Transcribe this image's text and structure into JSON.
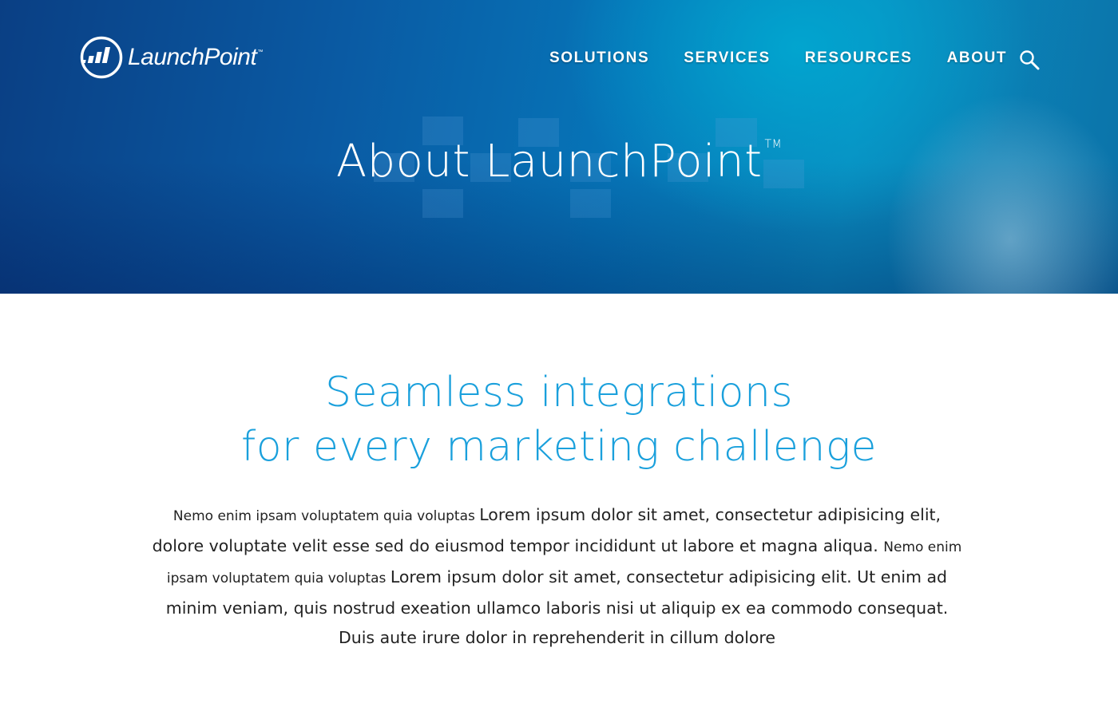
{
  "brand": {
    "name": "LaunchPoint",
    "tm": "™"
  },
  "nav": {
    "items": [
      {
        "label": "SOLUTIONS"
      },
      {
        "label": "SERVICES"
      },
      {
        "label": "RESOURCES"
      },
      {
        "label": "ABOUT"
      }
    ]
  },
  "hero": {
    "title": "About LaunchPoint",
    "tm": "TM"
  },
  "headline": {
    "line1": "Seamless integrations",
    "line2": "for every marketing challenge"
  },
  "body": {
    "seg1_small": "Nemo enim ipsam voluptatem quia voluptas ",
    "seg2": " Lorem ipsum dolor sit amet, consectetur adipisicing elit, dolore voluptate velit esse sed do eiusmod tempor incididunt ut labore et magna aliqua. ",
    "seg3_small": "Nemo enim ipsam voluptatem quia voluptas ",
    "seg4": " Lorem ipsum dolor sit amet, consectetur adipisicing elit. Ut enim ad minim veniam, quis nostrud exeation ullamco laboris nisi ut aliquip ex ea commodo consequat. Duis aute irure dolor in reprehenderit in cillum dolore"
  },
  "colors": {
    "headline": "#1aa0dc",
    "hero_dark": "#0a3f84",
    "hero_light": "#0a8cc0"
  },
  "icons": {
    "search": "search-icon",
    "logo": "launchpoint-logo-icon"
  }
}
